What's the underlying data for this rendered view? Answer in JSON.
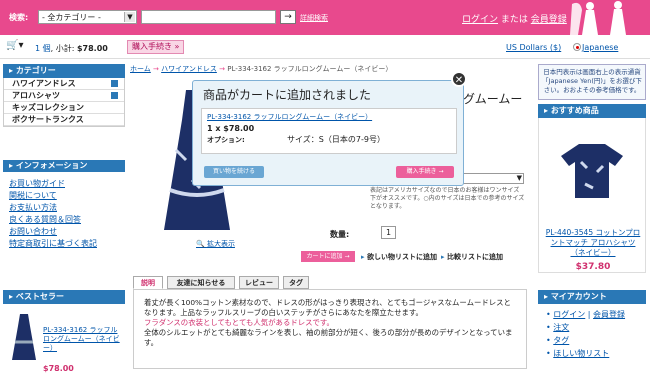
{
  "header": {
    "search_label": "検索:",
    "category_select": "- 全カテゴリー -",
    "advanced_search": "詳細検索",
    "login": "ログイン",
    "or": "または",
    "register": "会員登録"
  },
  "cartbar": {
    "count": "1",
    "count_unit": "個",
    "subtotal_label": "小計:",
    "subtotal": "$78.00",
    "checkout": "購入手続き",
    "currency": "US Dollars ($)",
    "language": "Japanese"
  },
  "sidebar": {
    "category_head": "カテゴリー",
    "categories": [
      "ハワイアンドレス",
      "アロハシャツ",
      "キッズコレクション",
      "ボクサートランクス"
    ],
    "info_head": "インフォメーション",
    "info": [
      "お買い物ガイド",
      "関税について",
      "お支払い方法",
      "良くある質問＆回答",
      "お問い合わせ",
      "特定商取引に基づく表記"
    ],
    "best_head": "ベストセラー",
    "best_title": "PL-334-3162 ラッフルロングムームー（ネイビー）",
    "best_price": "$78.00"
  },
  "breadcrumb": {
    "home": "ホーム",
    "cat": "ハワイアンドレス",
    "current": "PL-334-3162 ラッフルロングムームー（ネイビー）"
  },
  "product": {
    "title_tail": "グムームー",
    "zoom": "拡大表示",
    "qty_label": "数量:",
    "qty": "1",
    "add_cart": "カートに追加",
    "wishlist": "欲しい物リストに追加",
    "compare": "比較リストに追加",
    "size_note": "表記はアメリカサイズなので日本のお客様はワンサイズ下がオススメです。○内のサイズは日本での参考のサイズとなります。"
  },
  "modal": {
    "title": "商品がカートに追加されました",
    "item": "PL-334-3162 ラッフルロングムームー（ネイビー）",
    "qty_price": "1 x $78.00",
    "option_label": "オプション:",
    "option_value": "サイズ：S（日本の7-9号）",
    "continue": "買い物を続ける",
    "proceed": "購入手続き"
  },
  "tabs": [
    "説明",
    "友達に知らせる",
    "レビュー",
    "タグ"
  ],
  "description": {
    "l1": "着丈が長く100%コットン素材なので、ドレスの形がはっきり表現され、とてもゴージャスなムームードレスとなります。上品なラッフルスリーブの白いステッチがさらにあなたを際立たせます。",
    "l2": "フラダンスの衣装としてもとても人気があるドレスです。",
    "l3": "全体のシルエットがとても綺麗なラインを表し、袖の前部分が短く、後ろの部分が長めのデザインとなっています。"
  },
  "right": {
    "notice": "日本円表示は画面右上の表示通貨「Japanese Yen(円)」をお選び下さい。おおよその参考価格です。",
    "rec_head": "おすすめ商品",
    "rec_title": "PL-440-3545 コットンプロントマッチ アロハシャツ（ネイビー）",
    "rec_price": "$37.80",
    "acct_head": "マイアカウント",
    "acct": [
      "ログイン",
      "会員登録",
      "注文",
      "タグ",
      "ほしい物リスト"
    ]
  },
  "colors": {
    "brand": "#e8498d",
    "blue": "#2a78b6"
  }
}
